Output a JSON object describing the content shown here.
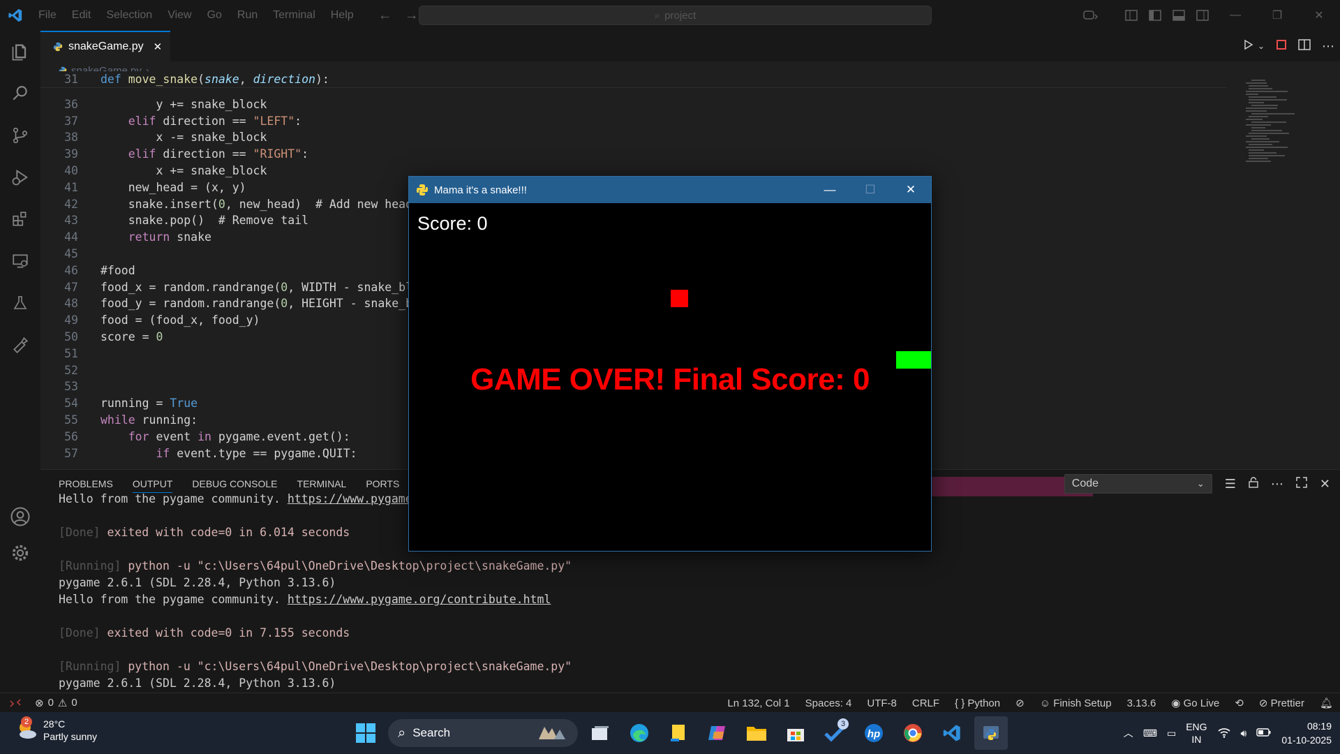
{
  "menu": [
    "File",
    "Edit",
    "Selection",
    "View",
    "Go",
    "Run",
    "Terminal",
    "Help"
  ],
  "search": {
    "text": "project"
  },
  "tab": {
    "label": "snakeGame.py",
    "close": "✕"
  },
  "breadcrumb": {
    "file": "snakeGame.py",
    "more": "..."
  },
  "code": [
    {
      "n": "31",
      "t": [
        [
          "kw2",
          "def "
        ],
        [
          "fn",
          "move_snake"
        ],
        [
          "op",
          "("
        ],
        [
          "par",
          "snake"
        ],
        [
          "op",
          ", "
        ],
        [
          "par",
          "direction"
        ],
        [
          "op",
          "):"
        ]
      ]
    },
    {
      "n": "36",
      "t": [
        [
          "op",
          "        y += snake_block"
        ]
      ]
    },
    {
      "n": "37",
      "t": [
        [
          "kw",
          "    elif "
        ],
        [
          "op",
          "direction == "
        ],
        [
          "str",
          "\"LEFT\""
        ],
        [
          "op",
          ":"
        ]
      ]
    },
    {
      "n": "38",
      "t": [
        [
          "op",
          "        x -= snake_block"
        ]
      ]
    },
    {
      "n": "39",
      "t": [
        [
          "kw",
          "    elif "
        ],
        [
          "op",
          "direction == "
        ],
        [
          "str",
          "\"RIGHT\""
        ],
        [
          "op",
          ":"
        ]
      ]
    },
    {
      "n": "40",
      "t": [
        [
          "op",
          "        x += snake_block"
        ]
      ]
    },
    {
      "n": "41",
      "t": [
        [
          "op",
          "    new_head = (x, y)"
        ]
      ]
    },
    {
      "n": "42",
      "t": [
        [
          "op",
          "    snake.insert("
        ],
        [
          "num",
          "0"
        ],
        [
          "op",
          ", new_head)  # Add new head"
        ]
      ]
    },
    {
      "n": "43",
      "t": [
        [
          "op",
          "    snake.pop()  # Remove tail"
        ]
      ]
    },
    {
      "n": "44",
      "t": [
        [
          "kw",
          "    return "
        ],
        [
          "op",
          "snake"
        ]
      ]
    },
    {
      "n": "45",
      "t": [
        [
          "op",
          ""
        ]
      ]
    },
    {
      "n": "46",
      "t": [
        [
          "op",
          "#food"
        ]
      ]
    },
    {
      "n": "47",
      "t": [
        [
          "op",
          "food_x = random.randrange("
        ],
        [
          "num",
          "0"
        ],
        [
          "op",
          ", WIDTH - snake_block"
        ]
      ]
    },
    {
      "n": "48",
      "t": [
        [
          "op",
          "food_y = random.randrange("
        ],
        [
          "num",
          "0"
        ],
        [
          "op",
          ", HEIGHT - snake_block"
        ]
      ]
    },
    {
      "n": "49",
      "t": [
        [
          "op",
          "food = (food_x, food_y)"
        ]
      ]
    },
    {
      "n": "50",
      "t": [
        [
          "op",
          "score = "
        ],
        [
          "num",
          "0"
        ]
      ]
    },
    {
      "n": "51",
      "t": [
        [
          "op",
          ""
        ]
      ]
    },
    {
      "n": "52",
      "t": [
        [
          "op",
          ""
        ]
      ]
    },
    {
      "n": "53",
      "t": [
        [
          "op",
          ""
        ]
      ]
    },
    {
      "n": "54",
      "t": [
        [
          "op",
          "running = "
        ],
        [
          "kw2",
          "True"
        ]
      ]
    },
    {
      "n": "55",
      "t": [
        [
          "kw",
          "while "
        ],
        [
          "op",
          "running:"
        ]
      ]
    },
    {
      "n": "56",
      "t": [
        [
          "kw",
          "    for "
        ],
        [
          "op",
          "event "
        ],
        [
          "kw",
          "in "
        ],
        [
          "op",
          "pygame.event.get():"
        ]
      ]
    },
    {
      "n": "57",
      "t": [
        [
          "kw",
          "        if "
        ],
        [
          "op",
          "event.type == pygame.QUIT:"
        ]
      ]
    }
  ],
  "panel": {
    "tabs": [
      "PROBLEMS",
      "OUTPUT",
      "DEBUG CONSOLE",
      "TERMINAL",
      "PORTS"
    ],
    "output_select": "Code"
  },
  "terminal": [
    [
      [
        "",
        "Hello from the pygame community. "
      ],
      [
        "link",
        "https://www.pygame.org/contribute.html"
      ]
    ],
    [
      [
        "",
        ""
      ]
    ],
    [
      [
        "dim",
        "[Done] "
      ],
      [
        "red",
        "exited with code=0 in 6.014 seconds"
      ]
    ],
    [
      [
        "",
        ""
      ]
    ],
    [
      [
        "dim",
        "[Running] "
      ],
      [
        "red",
        "python -u \"c:\\Users\\64pul\\OneDrive\\Desktop\\project\\snakeGame.py\""
      ]
    ],
    [
      [
        "",
        "pygame 2.6.1 (SDL 2.28.4, Python 3.13.6)"
      ]
    ],
    [
      [
        "",
        "Hello from the pygame community. "
      ],
      [
        "link",
        "https://www.pygame.org/contribute.html"
      ]
    ],
    [
      [
        "",
        ""
      ]
    ],
    [
      [
        "dim",
        "[Done] "
      ],
      [
        "red",
        "exited with code=0 in 7.155 seconds"
      ]
    ],
    [
      [
        "",
        ""
      ]
    ],
    [
      [
        "dim",
        "[Running] "
      ],
      [
        "red",
        "python -u \"c:\\Users\\64pul\\OneDrive\\Desktop\\project\\snakeGame.py\""
      ]
    ],
    [
      [
        "",
        "pygame 2.6.1 (SDL 2.28.4, Python 3.13.6)"
      ]
    ]
  ],
  "status": {
    "errors": "0",
    "warnings": "0",
    "position": "Ln 132, Col 1",
    "spaces": "Spaces: 4",
    "encoding": "UTF-8",
    "eol": "CRLF",
    "language": "Python",
    "finish_setup": "Finish Setup",
    "version": "3.13.6",
    "golive": "Go Live",
    "prettier": "Prettier"
  },
  "game": {
    "title": "Mama it's a snake!!!",
    "score": "Score: 0",
    "gameover": "GAME OVER! Final Score: 0"
  },
  "taskbar": {
    "temp": "28°C",
    "weather": "Partly sunny",
    "weather_badge": "2",
    "search": "Search",
    "todo_badge": "3",
    "lang1": "ENG",
    "lang2": "IN",
    "time": "08:19",
    "date": "01-10-2025"
  },
  "colors": {
    "accent": "#0078d4",
    "food": "#ff0000",
    "snake": "#00ff00",
    "gameover": "#ff0000"
  }
}
